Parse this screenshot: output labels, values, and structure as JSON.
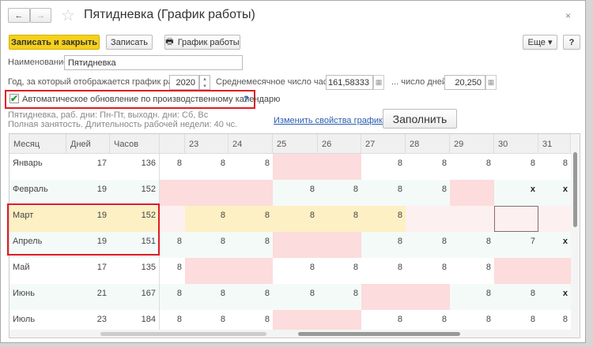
{
  "title": "Пятидневка (График работы)",
  "toolbar": {
    "save_close": "Записать и закрыть",
    "save": "Записать",
    "schedule": "График работы",
    "more": "Еще",
    "help": "?"
  },
  "form": {
    "name_label": "Наименование:",
    "name_value": "Пятидневка",
    "year_label": "Год, за который отображается график работы:",
    "year_value": "2020",
    "avg_hours_label": "Среднемесячное число часов:",
    "avg_hours_value": "161,58333",
    "avg_days_label": "... число дней:",
    "avg_days_value": "20,250",
    "auto_update_label": "Автоматическое обновление по производственному календарю",
    "auto_update_checked": true,
    "auto_update_help": "?",
    "description_line1": "Пятидневка, раб. дни: Пн-Пт, выходн. дни: Сб, Вс",
    "description_line2": "Полная занятость. Длительность рабочей недели: 40 чс.",
    "change_link": "Изменить свойства графика...",
    "fill_button": "Заполнить"
  },
  "table": {
    "headers": [
      "Месяц",
      "Дней",
      "Часов"
    ],
    "day_headers": [
      "",
      "23",
      "24",
      "25",
      "26",
      "27",
      "28",
      "29",
      "30",
      "31"
    ],
    "rows": [
      {
        "month": "Январь",
        "days": "17",
        "hours": "136",
        "cells": [
          "8",
          "8",
          "8",
          "h",
          "h",
          "8",
          "8",
          "8",
          "8",
          "8"
        ]
      },
      {
        "month": "Февраль",
        "days": "19",
        "hours": "152",
        "cells": [
          "h",
          "h",
          "h",
          "8",
          "8",
          "8",
          "8",
          "h",
          "x",
          "x"
        ]
      },
      {
        "month": "Март",
        "days": "19",
        "hours": "152",
        "cells": [
          "e",
          "8",
          "8",
          "8",
          "8",
          "8",
          "e",
          "e",
          "e",
          "e"
        ]
      },
      {
        "month": "Апрель",
        "days": "19",
        "hours": "151",
        "cells": [
          "8",
          "8",
          "8",
          "h",
          "h",
          "8",
          "8",
          "8",
          "7",
          "x"
        ]
      },
      {
        "month": "Май",
        "days": "17",
        "hours": "135",
        "cells": [
          "8",
          "h",
          "h",
          "8",
          "8",
          "8",
          "8",
          "8",
          "h",
          "h"
        ]
      },
      {
        "month": "Июнь",
        "days": "21",
        "hours": "167",
        "cells": [
          "8",
          "8",
          "8",
          "8",
          "8",
          "h",
          "h",
          "8",
          "8",
          "x"
        ]
      },
      {
        "month": "Июль",
        "days": "23",
        "hours": "184",
        "cells": [
          "8",
          "8",
          "8",
          "h",
          "h",
          "8",
          "8",
          "8",
          "8",
          "8"
        ]
      }
    ]
  },
  "colors": {
    "accent": "#f5d11b",
    "holiday": "#fcdcdc",
    "highlight": "#fdf0c4",
    "stripe": "#f4faf8",
    "link": "#2a5db0",
    "red": "#e01b24"
  }
}
